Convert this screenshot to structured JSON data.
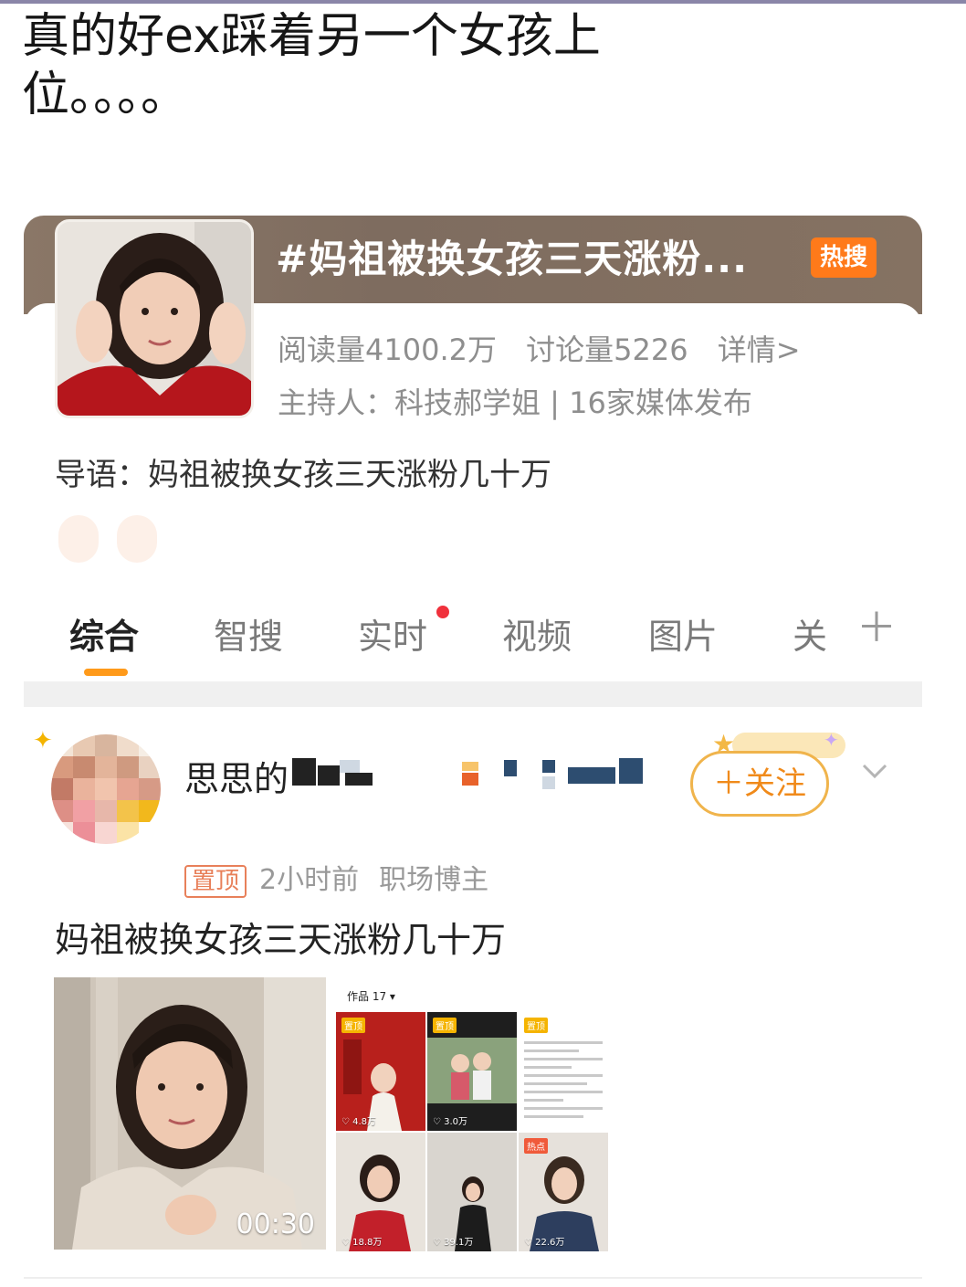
{
  "caption": {
    "line1": "真的好ex踩着另一个女孩上",
    "line2": "位。。。。"
  },
  "topic": {
    "title": "#妈祖被换女孩三天涨粉...",
    "badge": "热搜",
    "reads": "阅读量4100.2万",
    "discussions": "讨论量5226",
    "details_link": "详情>",
    "host": "主持人：科技郝学姐 | 16家媒体发布",
    "intro": "导语：妈祖被换女孩三天涨粉几十万"
  },
  "tabs": {
    "items": [
      "综合",
      "智搜",
      "实时",
      "视频",
      "图片",
      "关"
    ],
    "active": "综合"
  },
  "post": {
    "author_name": "思思的",
    "follow_label": "＋关注",
    "pinned_label": "置顶",
    "time": "2小时前",
    "author_title": "职场博主",
    "text": "妈祖被换女孩三天涨粉几十万",
    "video_duration": "00:30",
    "profile_shot": {
      "works_label": "作品 17 ▾",
      "cells": [
        {
          "badge": "置顶",
          "likes": "♡ 4.8万"
        },
        {
          "badge": "置顶",
          "likes": "♡ 3.0万"
        },
        {
          "badge": "置顶",
          "likes": ""
        },
        {
          "badge": "",
          "likes": "♡ 18.8万"
        },
        {
          "badge": "",
          "likes": "♡ 39.1万"
        },
        {
          "badge": "热点",
          "likes": "♡ 22.6万"
        }
      ]
    }
  },
  "colors": {
    "accent_orange": "#ff9a1a",
    "hot_badge": "#ff7a1a",
    "topic_band": "#7e6c5f",
    "red_dot": "#f0313c"
  }
}
